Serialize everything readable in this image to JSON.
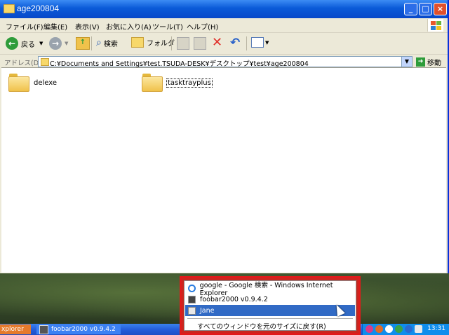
{
  "window": {
    "title": "age200804",
    "menu": [
      "ファイル(F)",
      "編集(E)",
      "表示(V)",
      "お気に入り(A)",
      "ツール(T)",
      "ヘルプ(H)"
    ],
    "toolbar": {
      "back_label": "戻る",
      "search_label": "検索",
      "folders_label": "フォルダ"
    },
    "address": {
      "label": "アドレス(D)",
      "value": "C:¥Documents and Settings¥test.TSUDA-DESK¥デスクトップ¥test¥age200804",
      "go_label": "移動"
    },
    "items": [
      {
        "name": "delexe",
        "selected": false
      },
      {
        "name": "tasktrayplus",
        "selected": true
      }
    ]
  },
  "popup_menu": {
    "items": [
      {
        "label": "google - Google 検索 - Windows Internet Explorer",
        "icon": "ie-icon",
        "selected": false
      },
      {
        "label": "foobar2000 v0.9.4.2",
        "icon": "foobar-icon",
        "selected": false
      },
      {
        "label": "Jane",
        "icon": "jane-icon",
        "selected": true
      }
    ],
    "restore_label": "すべてのウィンドウを元のサイズに戻す(R)"
  },
  "taskbar": {
    "left_button": "xplorer",
    "task_label": "foobar2000 v0.9.4.2",
    "clock": "13:31"
  },
  "colors": {
    "highlight": "#e01b1b",
    "selection": "#316ac5",
    "titlebar": "#0a5ad8"
  }
}
